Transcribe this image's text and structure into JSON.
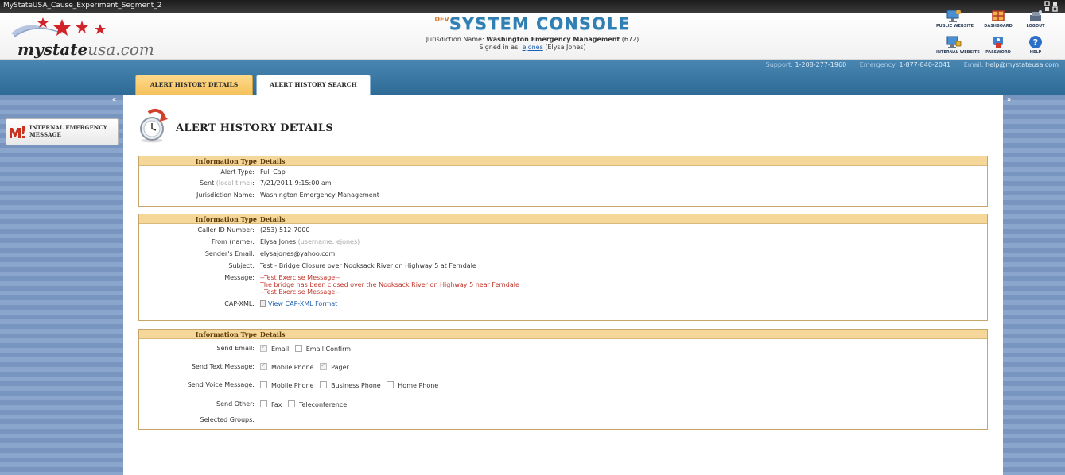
{
  "window": {
    "title": "MyStateUSA_Cause_Experiment_Segment_2"
  },
  "header": {
    "logo_brand": "mystate",
    "logo_suffix": "usa.com",
    "console_prefix": "DEV",
    "console_title": "SYSTEM CONSOLE",
    "jurisdiction_label": "Jurisdiction Name:",
    "jurisdiction_name": "Washington Emergency Management",
    "jurisdiction_id": "(672)",
    "signed_in_label": "Signed in as:",
    "signed_in_user": "ejones",
    "signed_in_name": "(Elysa Jones)",
    "icons": [
      {
        "label": "PUBLIC WEBSITE",
        "icon": "public-website-icon"
      },
      {
        "label": "DASHBOARD",
        "icon": "dashboard-icon"
      },
      {
        "label": "LOGOUT",
        "icon": "logout-icon"
      },
      {
        "label": "INTERNAL WEBSITE",
        "icon": "internal-website-icon"
      },
      {
        "label": "PASSWORD",
        "icon": "password-icon"
      },
      {
        "label": "HELP",
        "icon": "help-icon"
      }
    ]
  },
  "contact": {
    "support_label": "Support:",
    "support": "1-208-277-1960",
    "emergency_label": "Emergency:",
    "emergency": "1-877-840-2041",
    "email_label": "Email:",
    "email": "help@mystateusa.com"
  },
  "sidebar": {
    "collapse": "«",
    "expand": "»",
    "items": [
      {
        "line1": "INTERNAL EMERGENCY",
        "line2": "MESSAGE"
      }
    ]
  },
  "tabs": [
    {
      "label": "ALERT HISTORY DETAILS",
      "active": true
    },
    {
      "label": "ALERT HISTORY SEARCH",
      "active": false
    }
  ],
  "page": {
    "title": "ALERT HISTORY DETAILS"
  },
  "tables": {
    "header_left": "Information Type",
    "header_right": "Details",
    "summary": {
      "alert_type_label": "Alert Type:",
      "alert_type": "Full Cap",
      "sent_label": "Sent",
      "sent_note": "(local time)",
      "sent_colon": ":",
      "sent": "7/21/2011 9:15:00 am",
      "jurisdiction_label": "Jurisdiction Name:",
      "jurisdiction": "Washington Emergency Management"
    },
    "message": {
      "caller_label": "Caller ID Number:",
      "caller": "(253) 512-7000",
      "from_label": "From (name):",
      "from": "Elysa Jones",
      "from_note": "(username: ejones)",
      "email_label": "Sender's Email:",
      "email": "elysajones@yahoo.com",
      "subject_label": "Subject:",
      "subject": "Test - Bridge Closure over Nooksack River on Highway 5 at Ferndale",
      "message_label": "Message:",
      "message_lines": [
        "--Test Exercise Message--",
        "The bridge has been closed over the Nooksack River on Highway 5 near Ferndale",
        "--Test Exercise Message--"
      ],
      "cap_label": "CAP-XML:",
      "cap_link": "View CAP-XML Format"
    },
    "delivery": {
      "send_email_label": "Send Email:",
      "email_opts": [
        "Email",
        "Email Confirm"
      ],
      "send_text_label": "Send Text Message:",
      "text_opts": [
        "Mobile Phone",
        "Pager"
      ],
      "send_voice_label": "Send Voice Message:",
      "voice_opts": [
        "Mobile Phone",
        "Business Phone",
        "Home Phone"
      ],
      "send_other_label": "Send Other:",
      "other_opts": [
        "Fax",
        "Teleconference"
      ],
      "groups_label": "Selected Groups:"
    }
  }
}
